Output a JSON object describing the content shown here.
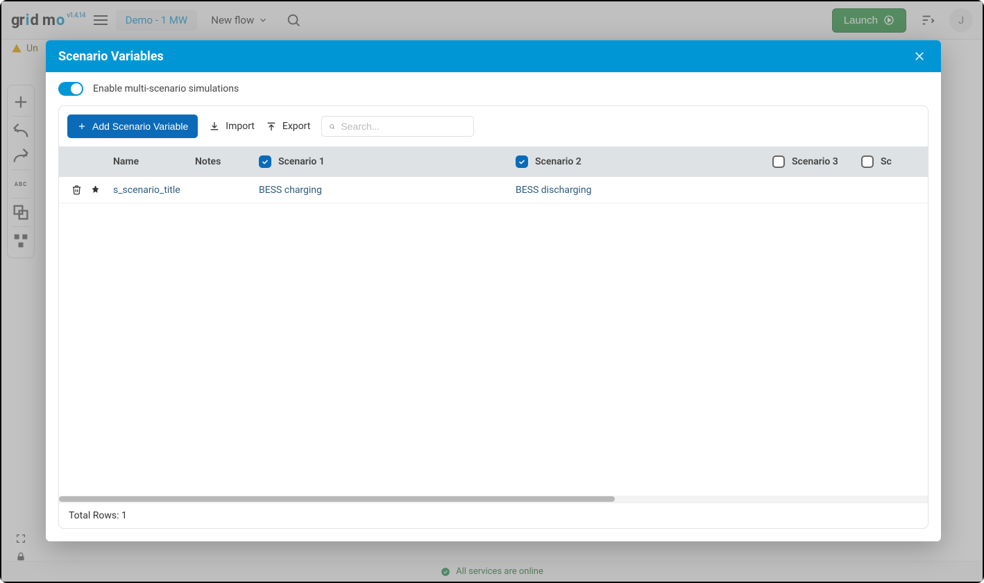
{
  "app": {
    "logo_text1": "gr",
    "logo_text2": "d",
    "logo_text3": "m",
    "version": "v1.4.14",
    "project_name": "Demo - 1 MW",
    "newflow_label": "New flow",
    "launch_label": "Launch",
    "avatar_initial": "J",
    "warn_text": "Un",
    "status_text": "All services are online"
  },
  "modal": {
    "title": "Scenario Variables",
    "enable_label": "Enable multi-scenario simulations",
    "toolbar": {
      "add_label": "Add Scenario Variable",
      "import_label": "Import",
      "export_label": "Export",
      "search_placeholder": "Search..."
    },
    "columns": {
      "name": "Name",
      "notes": "Notes",
      "scenarios": [
        {
          "label": "Scenario 1",
          "checked": true
        },
        {
          "label": "Scenario 2",
          "checked": true
        },
        {
          "label": "Scenario 3",
          "checked": false
        },
        {
          "label": "Sc",
          "checked": false
        }
      ]
    },
    "rows": [
      {
        "name": "s_scenario_title",
        "notes": "",
        "values": [
          "BESS charging",
          "BESS discharging",
          "",
          ""
        ]
      }
    ],
    "footer_prefix": "Total Rows: ",
    "footer_count": "1"
  }
}
